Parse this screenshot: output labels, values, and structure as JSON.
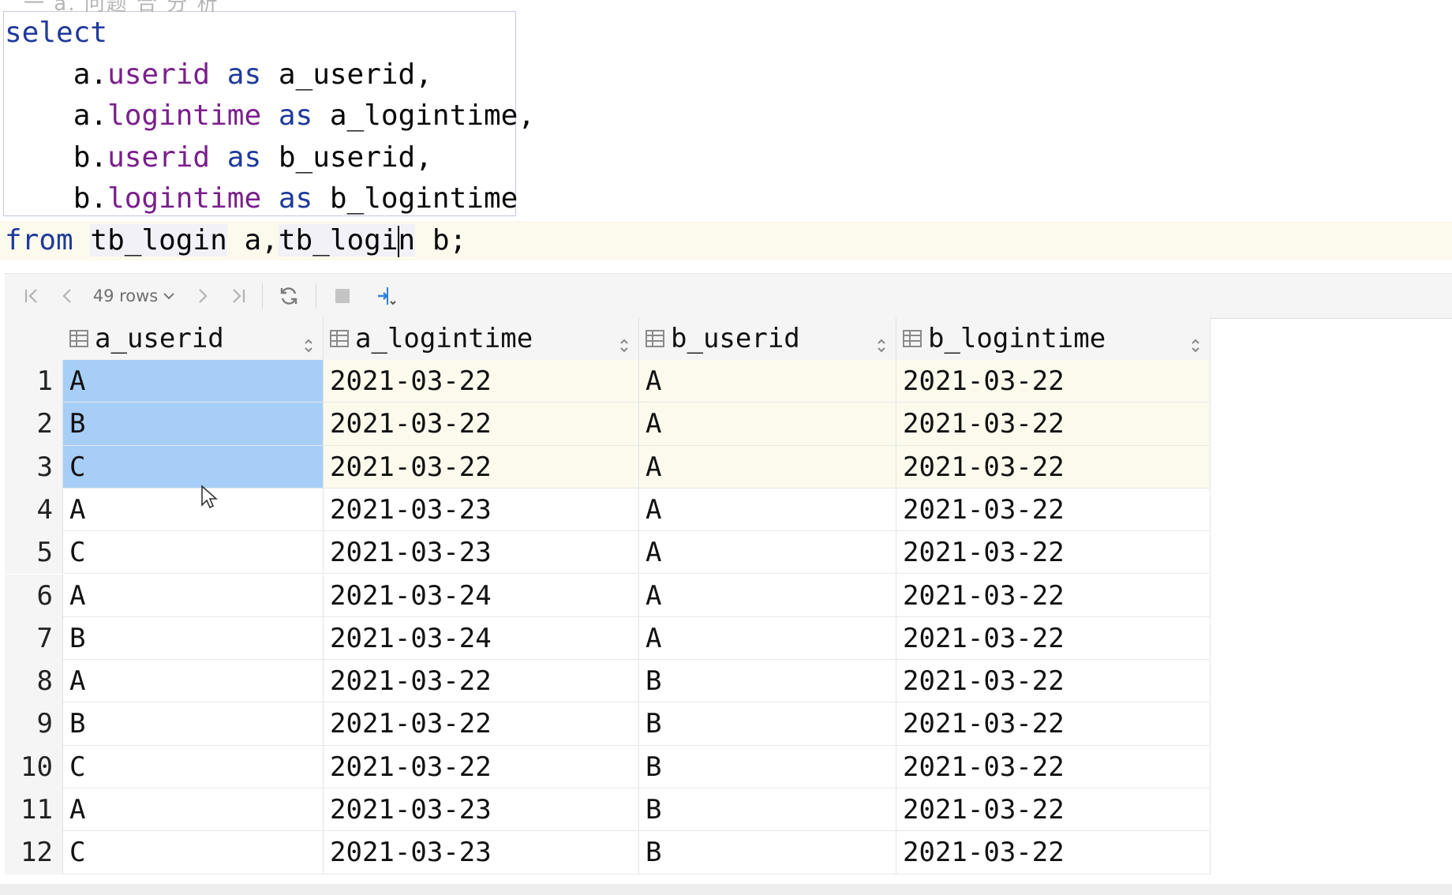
{
  "editor": {
    "hint_stub": "一 a. 问题 合 分 析",
    "lines": {
      "l1": {
        "kw": "select"
      },
      "l2": {
        "indent": "    ",
        "alias": "a.",
        "col": "userid",
        "kw": "as",
        "target": "a_userid,"
      },
      "l3": {
        "indent": "    ",
        "alias": "a.",
        "col": "logintime",
        "kw": "as",
        "target": "a_logintime,"
      },
      "l4": {
        "indent": "    ",
        "alias": "b.",
        "col": "userid",
        "kw": "as",
        "target": "b_userid,"
      },
      "l5": {
        "indent": "    ",
        "alias": "b.",
        "col": "logintime",
        "kw": "as",
        "target": "b_logintime"
      },
      "l6": {
        "kw": "from",
        "t1": "tb_login",
        "a1": " a,",
        "t2a": "tb_logi",
        "t2b": "n",
        "a2": " b;"
      }
    }
  },
  "toolbar": {
    "rows_label": "49 rows",
    "icons": [
      "first-page-icon",
      "prev-page-icon",
      "next-page-icon",
      "last-page-icon",
      "refresh-icon",
      "stop-icon",
      "compare-icon"
    ]
  },
  "grid": {
    "columns": [
      "a_userid",
      "a_logintime",
      "b_userid",
      "b_logintime"
    ],
    "rows": [
      {
        "n": "1",
        "c": [
          "A",
          "2021-03-22",
          "A",
          "2021-03-22"
        ]
      },
      {
        "n": "2",
        "c": [
          "B",
          "2021-03-22",
          "A",
          "2021-03-22"
        ]
      },
      {
        "n": "3",
        "c": [
          "C",
          "2021-03-22",
          "A",
          "2021-03-22"
        ]
      },
      {
        "n": "4",
        "c": [
          "A",
          "2021-03-23",
          "A",
          "2021-03-22"
        ]
      },
      {
        "n": "5",
        "c": [
          "C",
          "2021-03-23",
          "A",
          "2021-03-22"
        ]
      },
      {
        "n": "6",
        "c": [
          "A",
          "2021-03-24",
          "A",
          "2021-03-22"
        ]
      },
      {
        "n": "7",
        "c": [
          "B",
          "2021-03-24",
          "A",
          "2021-03-22"
        ]
      },
      {
        "n": "8",
        "c": [
          "A",
          "2021-03-22",
          "B",
          "2021-03-22"
        ]
      },
      {
        "n": "9",
        "c": [
          "B",
          "2021-03-22",
          "B",
          "2021-03-22"
        ]
      },
      {
        "n": "10",
        "c": [
          "C",
          "2021-03-22",
          "B",
          "2021-03-22"
        ]
      },
      {
        "n": "11",
        "c": [
          "A",
          "2021-03-23",
          "B",
          "2021-03-22"
        ]
      },
      {
        "n": "12",
        "c": [
          "C",
          "2021-03-23",
          "B",
          "2021-03-22"
        ]
      }
    ],
    "selected_rows": [
      "1",
      "2",
      "3"
    ],
    "selected_column": "a_userid"
  },
  "colors": {
    "keyword": "#1f3a9a",
    "column": "#7a1f8c",
    "selection": "#a6cef7",
    "current_line": "#fcfaed"
  }
}
